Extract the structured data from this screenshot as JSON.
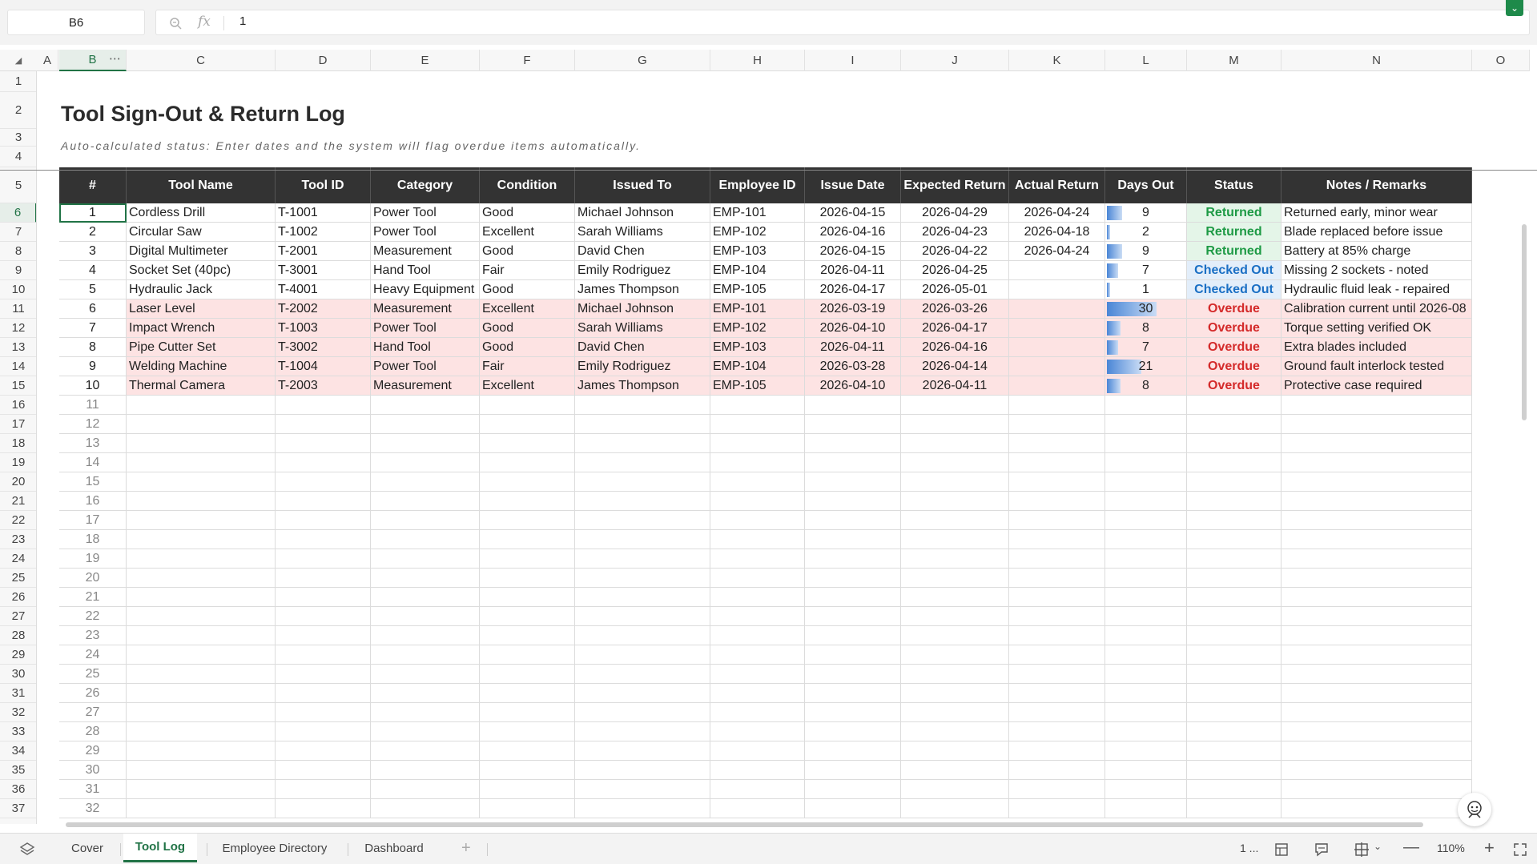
{
  "formula_bar": {
    "cell_ref": "B6",
    "fx_label": "fx",
    "value": "1"
  },
  "columns": [
    "A",
    "B",
    "C",
    "D",
    "E",
    "F",
    "G",
    "H",
    "I",
    "J",
    "K",
    "L",
    "M",
    "N",
    "O"
  ],
  "rows": [
    "1",
    "2",
    "3",
    "4",
    "5",
    "6",
    "7",
    "8",
    "9",
    "10",
    "11",
    "12",
    "13",
    "14",
    "15",
    "16",
    "17",
    "18",
    "19",
    "20",
    "21",
    "22",
    "23",
    "24",
    "25",
    "26",
    "27",
    "28",
    "29",
    "30",
    "31",
    "32",
    "33",
    "34",
    "35",
    "36",
    "37"
  ],
  "sheet": {
    "title": "Tool Sign-Out & Return Log",
    "subtitle": "Auto-calculated status: Enter dates and the system will flag overdue items automatically.",
    "headers": [
      "#",
      "Tool Name",
      "Tool ID",
      "Category",
      "Condition",
      "Issued To",
      "Employee ID",
      "Issue Date",
      "Expected Return",
      "Actual Return",
      "Days Out",
      "Status",
      "Notes / Remarks"
    ],
    "records": [
      {
        "num": "1",
        "tool": "Cordless Drill",
        "id": "T-1001",
        "category": "Power Tool",
        "condition": "Good",
        "issued_to": "Michael Johnson",
        "emp": "EMP-101",
        "issue": "2026-04-15",
        "expected": "2026-04-29",
        "actual": "2026-04-24",
        "days": "9",
        "status": "Returned",
        "notes": "Returned early, minor wear"
      },
      {
        "num": "2",
        "tool": "Circular Saw",
        "id": "T-1002",
        "category": "Power Tool",
        "condition": "Excellent",
        "issued_to": "Sarah Williams",
        "emp": "EMP-102",
        "issue": "2026-04-16",
        "expected": "2026-04-23",
        "actual": "2026-04-18",
        "days": "2",
        "status": "Returned",
        "notes": "Blade replaced before issue"
      },
      {
        "num": "3",
        "tool": "Digital Multimeter",
        "id": "T-2001",
        "category": "Measurement",
        "condition": "Good",
        "issued_to": "David Chen",
        "emp": "EMP-103",
        "issue": "2026-04-15",
        "expected": "2026-04-22",
        "actual": "2026-04-24",
        "days": "9",
        "status": "Returned",
        "notes": "Battery at 85% charge"
      },
      {
        "num": "4",
        "tool": "Socket Set (40pc)",
        "id": "T-3001",
        "category": "Hand Tool",
        "condition": "Fair",
        "issued_to": "Emily Rodriguez",
        "emp": "EMP-104",
        "issue": "2026-04-11",
        "expected": "2026-04-25",
        "actual": "",
        "days": "7",
        "status": "Checked Out",
        "notes": "Missing 2 sockets - noted"
      },
      {
        "num": "5",
        "tool": "Hydraulic Jack",
        "id": "T-4001",
        "category": "Heavy Equipment",
        "condition": "Good",
        "issued_to": "James Thompson",
        "emp": "EMP-105",
        "issue": "2026-04-17",
        "expected": "2026-05-01",
        "actual": "",
        "days": "1",
        "status": "Checked Out",
        "notes": "Hydraulic fluid leak - repaired"
      },
      {
        "num": "6",
        "tool": "Laser Level",
        "id": "T-2002",
        "category": "Measurement",
        "condition": "Excellent",
        "issued_to": "Michael Johnson",
        "emp": "EMP-101",
        "issue": "2026-03-19",
        "expected": "2026-03-26",
        "actual": "",
        "days": "30",
        "status": "Overdue",
        "notes": "Calibration current until 2026-08"
      },
      {
        "num": "7",
        "tool": "Impact Wrench",
        "id": "T-1003",
        "category": "Power Tool",
        "condition": "Good",
        "issued_to": "Sarah Williams",
        "emp": "EMP-102",
        "issue": "2026-04-10",
        "expected": "2026-04-17",
        "actual": "",
        "days": "8",
        "status": "Overdue",
        "notes": "Torque setting verified OK"
      },
      {
        "num": "8",
        "tool": "Pipe Cutter Set",
        "id": "T-3002",
        "category": "Hand Tool",
        "condition": "Good",
        "issued_to": "David Chen",
        "emp": "EMP-103",
        "issue": "2026-04-11",
        "expected": "2026-04-16",
        "actual": "",
        "days": "7",
        "status": "Overdue",
        "notes": "Extra blades included"
      },
      {
        "num": "9",
        "tool": "Welding Machine",
        "id": "T-1004",
        "category": "Power Tool",
        "condition": "Fair",
        "issued_to": "Emily Rodriguez",
        "emp": "EMP-104",
        "issue": "2026-03-28",
        "expected": "2026-04-14",
        "actual": "",
        "days": "21",
        "status": "Overdue",
        "notes": "Ground fault interlock tested"
      },
      {
        "num": "10",
        "tool": "Thermal Camera",
        "id": "T-2003",
        "category": "Measurement",
        "condition": "Excellent",
        "issued_to": "James Thompson",
        "emp": "EMP-105",
        "issue": "2026-04-10",
        "expected": "2026-04-11",
        "actual": "",
        "days": "8",
        "status": "Overdue",
        "notes": "Protective case required"
      }
    ],
    "empty_numbers": [
      "11",
      "12",
      "13",
      "14",
      "15",
      "16",
      "17",
      "18",
      "19",
      "20",
      "21",
      "22",
      "23",
      "24",
      "25",
      "26",
      "27",
      "28",
      "29",
      "30",
      "31",
      "32"
    ]
  },
  "tabs": [
    "Cover",
    "Tool Log",
    "Employee Directory",
    "Dashboard"
  ],
  "active_tab": "Tool Log",
  "status_bar": {
    "count": "1 ...",
    "zoom": "110%"
  },
  "colors": {
    "accent": "#217346",
    "header_bg": "#333333",
    "overdue_bg": "#fde3e3",
    "returned": "#1e9a45",
    "checked_out": "#1a6fc4",
    "overdue": "#d42a2a"
  },
  "icons": [
    "zoom-icon",
    "layers-icon",
    "add-sheet-icon",
    "page-layout-icon",
    "comment-icon",
    "freeze-icon",
    "zoom-out-icon",
    "zoom-in-icon",
    "fullscreen-icon",
    "assistant-icon",
    "expand-icon"
  ]
}
